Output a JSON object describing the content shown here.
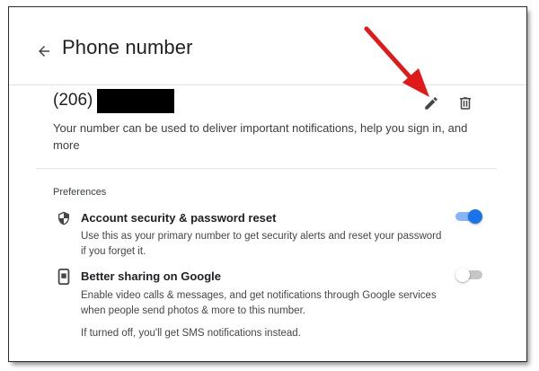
{
  "header": {
    "title": "Phone number"
  },
  "phone": {
    "prefix": "(206)",
    "description": "Your number can be used to deliver important notifications, help you sign in, and more"
  },
  "preferences": {
    "heading": "Preferences",
    "items": [
      {
        "title": "Account security & password reset",
        "description": "Use this as your primary number to get security alerts and reset your password if you forget it.",
        "enabled": true,
        "icon": "shield-icon"
      },
      {
        "title": "Better sharing on Google",
        "description": "Enable video calls & messages, and get notifications through Google services when people send photos & more to this number.",
        "enabled": false,
        "icon": "phone-device-icon"
      }
    ],
    "footnote": "If turned off, you'll get SMS notifications instead."
  },
  "colors": {
    "accent": "#1a73e8",
    "annotation_arrow": "#e0191a"
  }
}
